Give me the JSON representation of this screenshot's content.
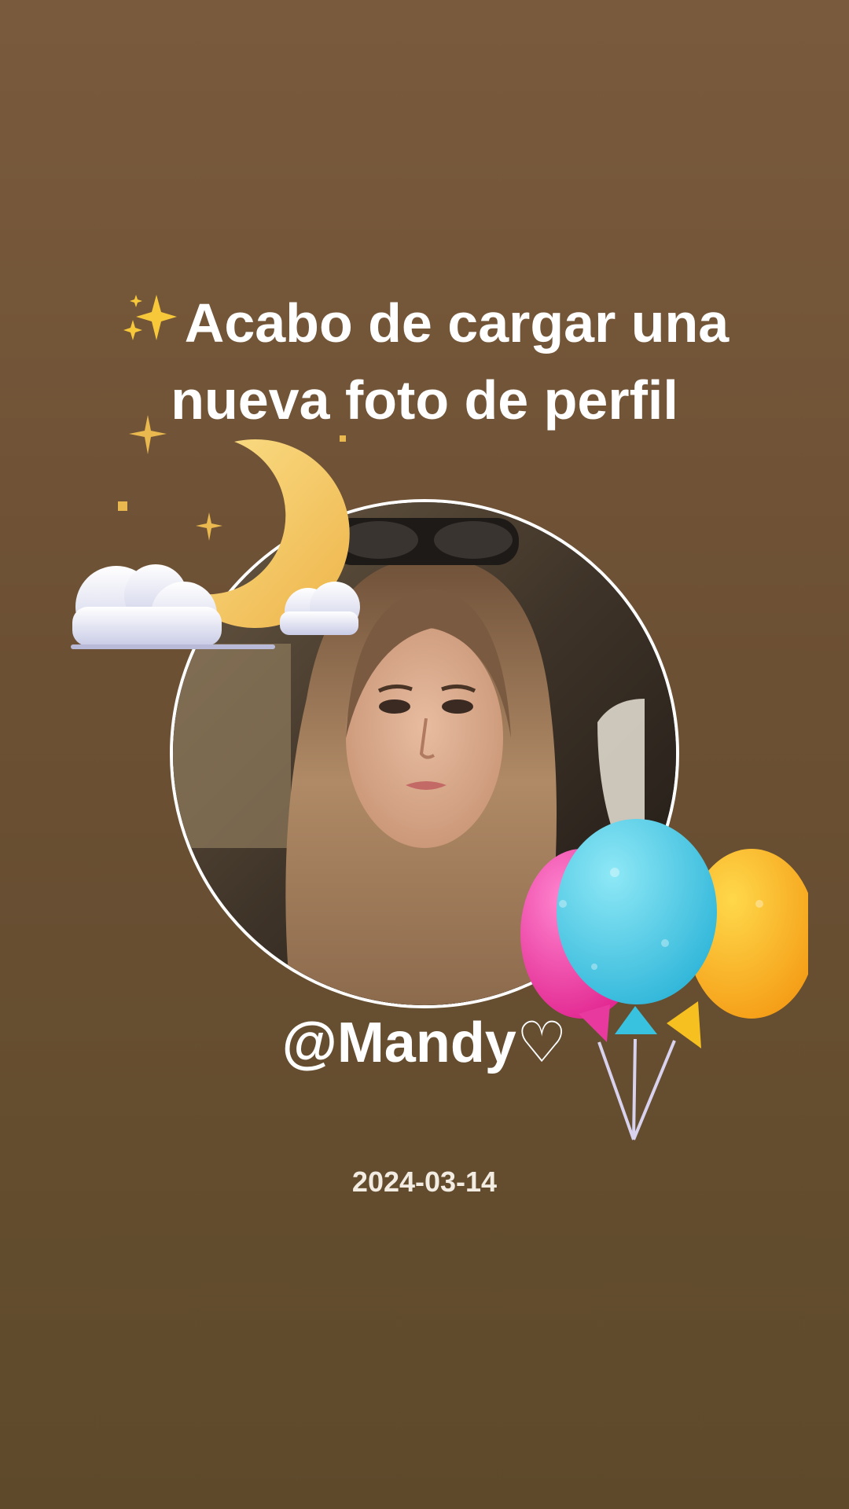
{
  "headline": {
    "emoji": "✨",
    "text": "Acabo de cargar una nueva foto de perfil"
  },
  "profile": {
    "username": "@Mandy♡",
    "date": "2024-03-14"
  },
  "decorations": {
    "top_left": "moon-clouds-sticker",
    "bottom_right": "balloons-sticker"
  },
  "colors": {
    "background_top": "#7a5a3c",
    "background_bottom": "#5e4a2b",
    "text": "#ffffff",
    "ring": "#ffffff"
  }
}
